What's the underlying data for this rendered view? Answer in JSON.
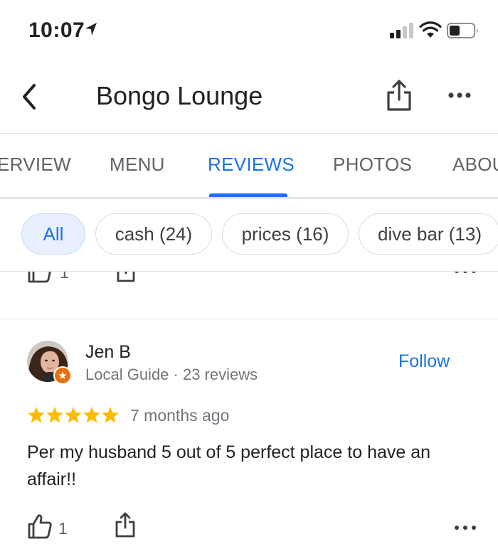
{
  "status_bar": {
    "time": "10:07",
    "icons": [
      "location-arrow-icon",
      "cellular-signal-icon",
      "wifi-icon",
      "battery-icon"
    ]
  },
  "header": {
    "title": "Bongo Lounge",
    "icons": [
      "back-chevron-icon",
      "share-icon",
      "more-horizontal-icon"
    ]
  },
  "tabs": [
    {
      "label": "OVERVIEW",
      "visible_text": "ERVIEW",
      "active": false
    },
    {
      "label": "MENU",
      "visible_text": "MENU",
      "active": false
    },
    {
      "label": "REVIEWS",
      "visible_text": "REVIEWS",
      "active": true
    },
    {
      "label": "PHOTOS",
      "visible_text": "PHOTOS",
      "active": false
    },
    {
      "label": "ABOUT",
      "visible_text": "ABOU",
      "active": false
    }
  ],
  "filter_chips": [
    {
      "label": "All",
      "selected": true
    },
    {
      "label": "cash (24)",
      "selected": false
    },
    {
      "label": "prices (16)",
      "selected": false
    },
    {
      "label": "dive bar (13)",
      "selected": false
    }
  ],
  "previous_review": {
    "like_count": "1"
  },
  "review": {
    "reviewer_name": "Jen B",
    "reviewer_meta": "Local Guide · 23 reviews",
    "follow_label": "Follow",
    "rating": 5,
    "max_rating": 5,
    "time_ago": "7 months ago",
    "text": "Per my husband 5 out of 5 perfect place to have an affair!!",
    "like_count": "1"
  },
  "colors": {
    "accent": "#1a73e8",
    "star": "#fbbc04",
    "local_guide_badge": "#e8710a",
    "chip_selected_bg": "#e8f0fe",
    "secondary_text": "#70757a"
  }
}
